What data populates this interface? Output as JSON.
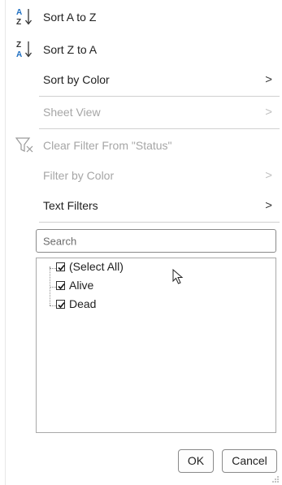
{
  "menu": {
    "sort_az": {
      "label": "Sort A to Z",
      "icon": "sort-ascending-icon"
    },
    "sort_za": {
      "label": "Sort Z to A",
      "icon": "sort-descending-icon"
    },
    "sort_by_color": {
      "label": "Sort by Color",
      "chevron": ">"
    },
    "sheet_view": {
      "label": "Sheet View",
      "chevron": ">",
      "enabled": false
    },
    "clear_filter": {
      "label": "Clear Filter From \"Status\"",
      "icon": "clear-filter-icon",
      "enabled": false
    },
    "filter_by_color": {
      "label": "Filter by Color",
      "chevron": ">",
      "enabled": false
    },
    "text_filters": {
      "label": "Text Filters",
      "chevron": ">"
    }
  },
  "search": {
    "placeholder": "Search"
  },
  "values_list": {
    "items": [
      {
        "label": "(Select All)",
        "checked": true
      },
      {
        "label": "Alive",
        "checked": true
      },
      {
        "label": "Dead",
        "checked": true
      }
    ]
  },
  "buttons": {
    "ok": "OK",
    "cancel": "Cancel"
  },
  "colors": {
    "accent_blue": "#1f6fc2",
    "disabled_text": "#a6a6a6"
  }
}
